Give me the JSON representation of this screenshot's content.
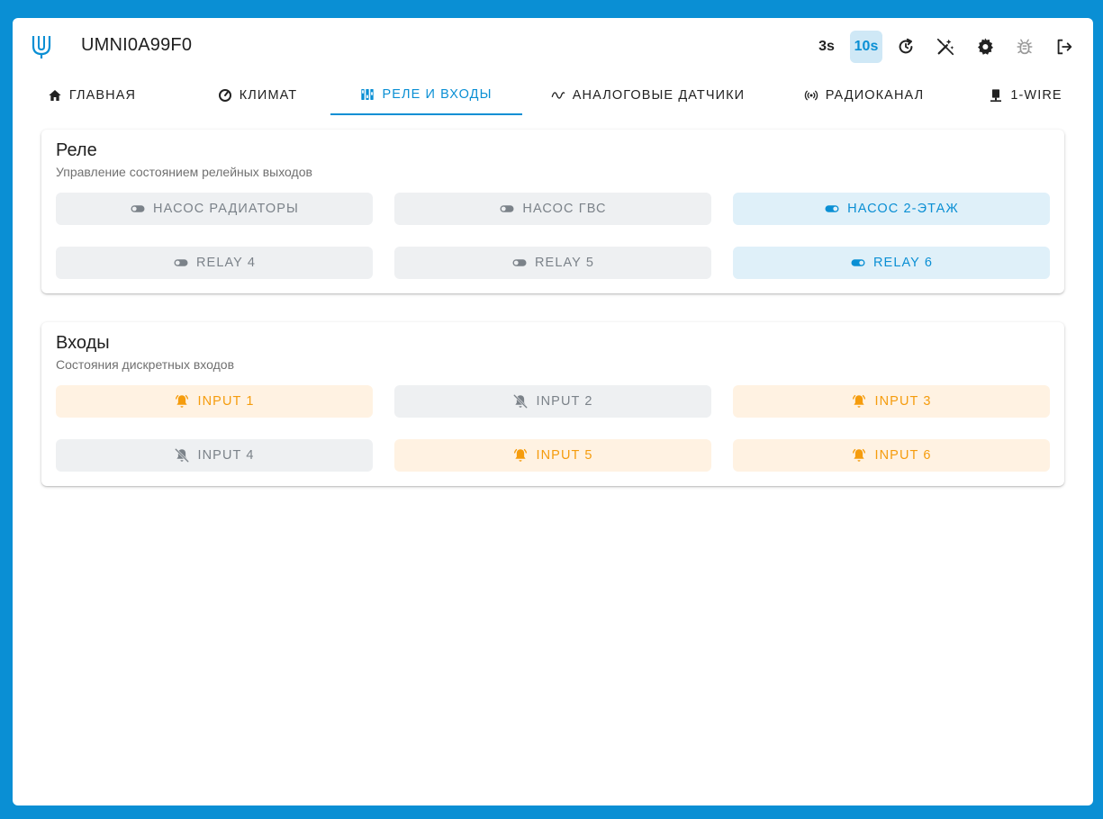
{
  "header": {
    "device_name": "UMNI0A99F0",
    "toolbar": {
      "interval_3s": "3s",
      "interval_10s": "10s",
      "active_interval": "10s",
      "icons": [
        "refresh-icon",
        "auto-fix-off-icon",
        "gear-icon",
        "bug-icon",
        "logout-icon"
      ]
    }
  },
  "tabs": [
    {
      "label": "ГЛАВНАЯ",
      "icon": "home-icon"
    },
    {
      "label": "КЛИМАТ",
      "icon": "gauge-icon"
    },
    {
      "label": "РЕЛЕ И ВХОДЫ",
      "icon": "switches-icon",
      "active": true
    },
    {
      "label": "АНАЛОГОВЫЕ ДАТЧИКИ",
      "icon": "sine-wave-icon"
    },
    {
      "label": "РАДИОКАНАЛ",
      "icon": "radio-icon"
    },
    {
      "label": "1-WIRE",
      "icon": "wire-icon"
    }
  ],
  "relays": {
    "title": "Реле",
    "subtitle": "Управление состоянием релейных выходов",
    "items": [
      {
        "label": "НАСОС РАДИАТОРЫ",
        "state": "off"
      },
      {
        "label": "НАСОС ГВС",
        "state": "off"
      },
      {
        "label": "НАСОС 2-ЭТАЖ",
        "state": "on"
      },
      {
        "label": "RELAY 4",
        "state": "off"
      },
      {
        "label": "RELAY 5",
        "state": "off"
      },
      {
        "label": "RELAY 6",
        "state": "on"
      }
    ]
  },
  "inputs": {
    "title": "Входы",
    "subtitle": "Состояния дискретных входов",
    "items": [
      {
        "label": "INPUT 1",
        "state": "alarm"
      },
      {
        "label": "INPUT 2",
        "state": "quiet"
      },
      {
        "label": "INPUT 3",
        "state": "alarm"
      },
      {
        "label": "INPUT 4",
        "state": "quiet"
      },
      {
        "label": "INPUT 5",
        "state": "alarm"
      },
      {
        "label": "INPUT 6",
        "state": "alarm"
      }
    ]
  },
  "colors": {
    "accent": "#0a8fd4",
    "alarm": "#f59c0d",
    "inactive": "#7b8289"
  }
}
